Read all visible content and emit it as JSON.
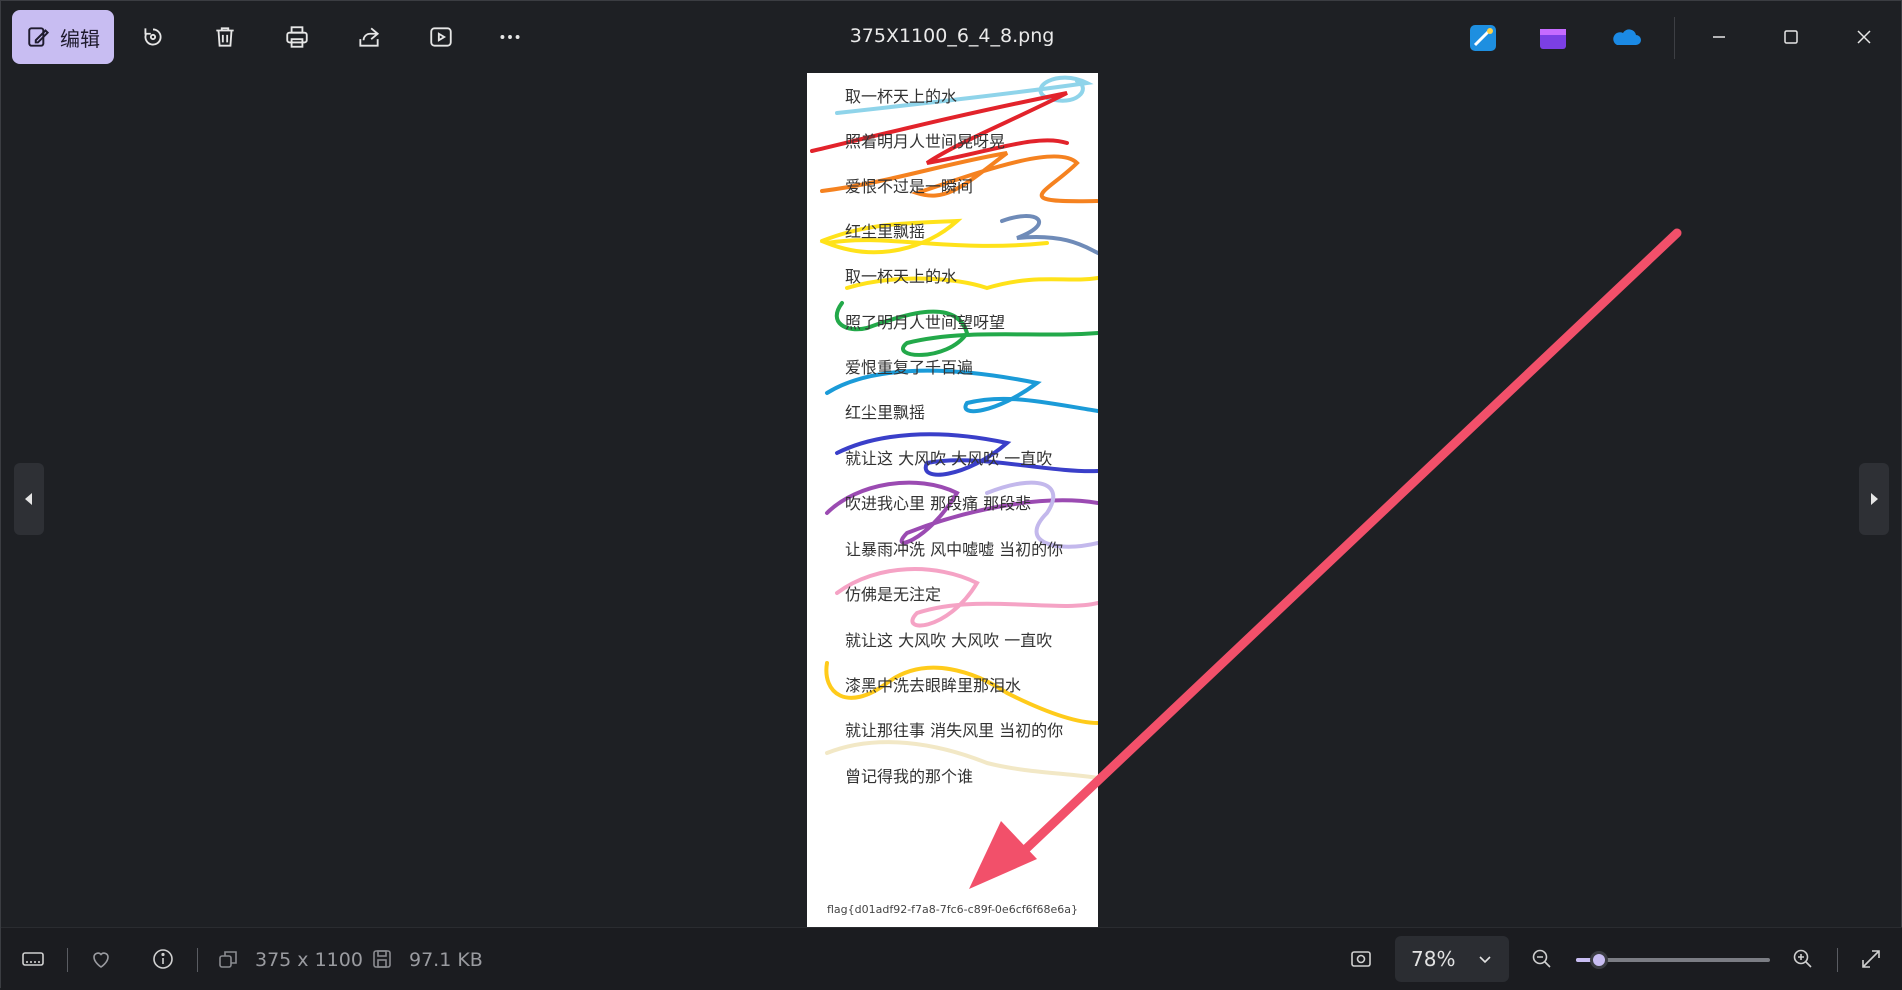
{
  "toolbar": {
    "edit_label": "编辑",
    "file_title": "375X1100_6_4_8.png"
  },
  "image": {
    "lyrics": [
      "取一杯天上的水",
      "照着明月人世间晃呀晃",
      "爱恨不过是一瞬间",
      "红尘里飘摇",
      "取一杯天上的水",
      "照了明月人世间望呀望",
      "爱恨重复了千百遍",
      "红尘里飘摇",
      "就让这 大风吹 大风吹 一直吹",
      "吹进我心里 那段痛 那段悲",
      "让暴雨冲洗 风中嘘嘘 当初的你",
      "仿佛是无注定",
      "就让这 大风吹 大风吹 一直吹",
      "漆黑中洗去眼眸里那泪水",
      "就让那往事 消失风里 当初的你",
      "曾记得我的那个谁"
    ],
    "flag": "flag{d01adf92-f7a8-7fc6-c89f-0e6cf6f68e6a}"
  },
  "statusbar": {
    "dimensions": "375 x 1100",
    "file_size": "97.1 KB",
    "zoom_level": "78%",
    "zoom_slider_fraction": 0.12
  },
  "colors": {
    "accent": "#c8bdf2",
    "annotation_arrow": "#f2506a"
  },
  "icons": {
    "edit": "edit-icon",
    "rotate": "rotate-icon",
    "delete": "trash-icon",
    "print": "print-icon",
    "share": "share-icon",
    "slideshow": "slideshow-icon",
    "more": "more-icon",
    "favorite": "heart-icon",
    "info": "info-icon"
  }
}
